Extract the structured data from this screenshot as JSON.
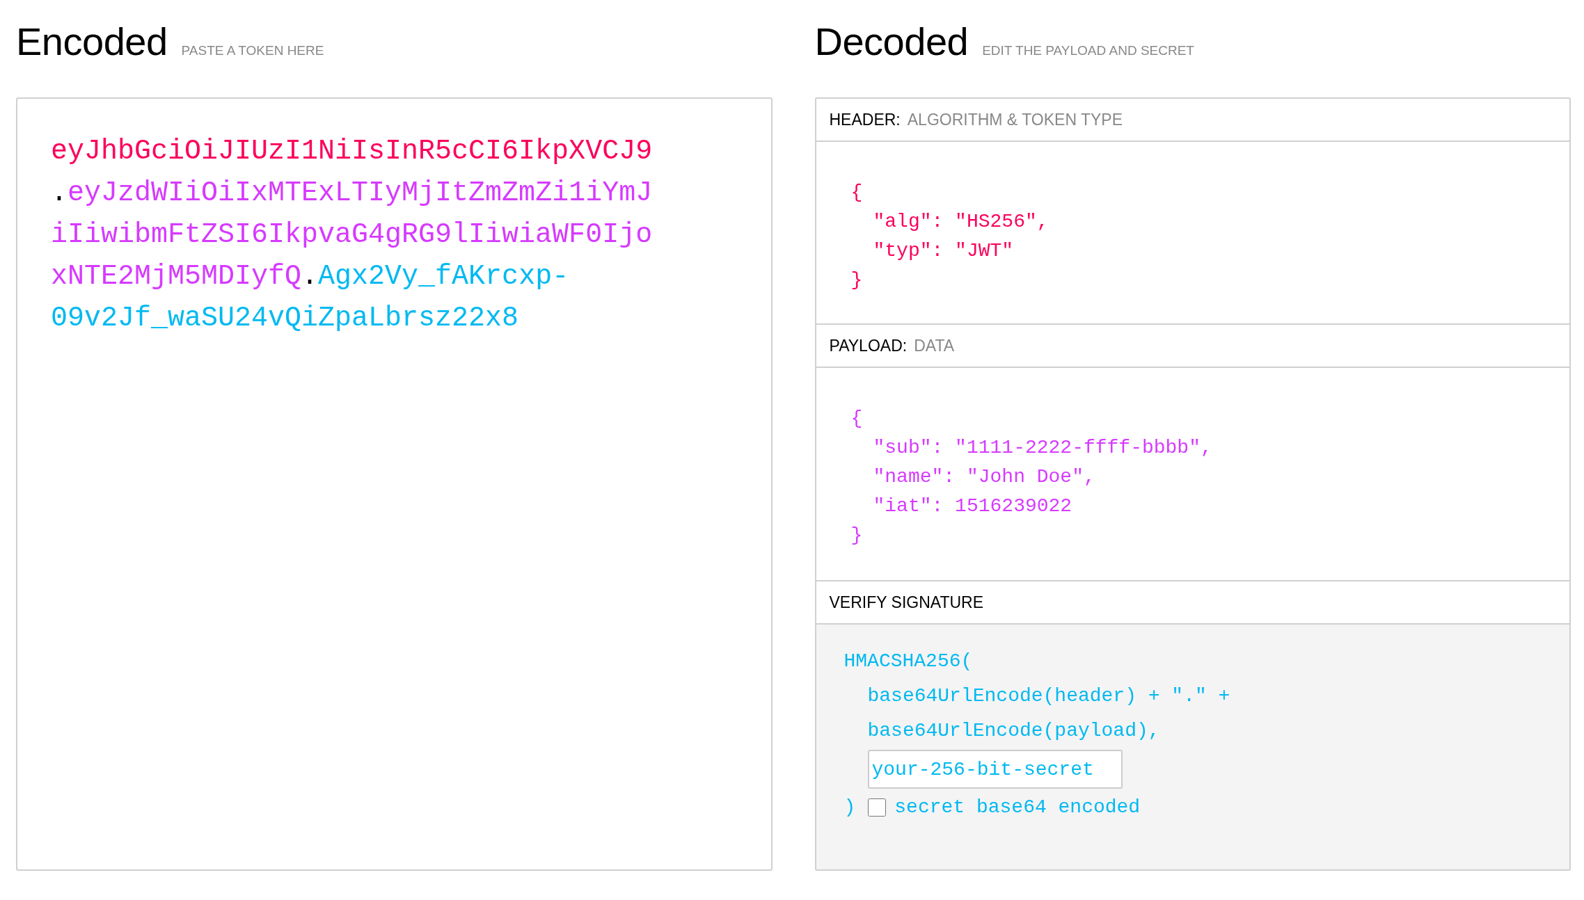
{
  "encoded": {
    "title": "Encoded",
    "subtitle": "PASTE A TOKEN HERE",
    "token": [
      {
        "kind": "header",
        "text": "eyJhbGciOiJIUzI1NiIsInR5cCI6IkpXVCJ9"
      },
      {
        "kind": "separator",
        "text": "."
      },
      {
        "kind": "payload",
        "text": "eyJzdWIiOiIxMTExLTIyMjItZmZmZi1iYmJiIiwibmFtZSI6IkpvaG4gRG9lIiwiaWF0IjoxNTE2MjM5MDIyfQ"
      },
      {
        "kind": "separator",
        "text": "."
      },
      {
        "kind": "signature",
        "text": "Agx2Vy_fAKrcxp-09v2Jf_waSU24vQiZpaLbrsz22x8"
      }
    ]
  },
  "decoded": {
    "title": "Decoded",
    "subtitle": "EDIT THE PAYLOAD AND SECRET",
    "header": {
      "label": "HEADER:",
      "sublabel": "ALGORITHM & TOKEN TYPE",
      "open": "{",
      "entries": [
        "\"alg\": \"HS256\",",
        "\"typ\": \"JWT\""
      ],
      "close": "}"
    },
    "payload": {
      "label": "PAYLOAD:",
      "sublabel": "DATA",
      "open": "{",
      "entries": [
        "\"sub\": \"1111-2222-ffff-bbbb\",",
        "\"name\": \"John Doe\",",
        "\"iat\": 1516239022"
      ],
      "close": "}"
    },
    "verify": {
      "label": "VERIFY SIGNATURE",
      "call": "HMACSHA256(",
      "args": [
        "base64UrlEncode(header) + \".\" +",
        "base64UrlEncode(payload),"
      ],
      "secret": {
        "value": "your-256-bit-secret"
      },
      "close": ")",
      "base64_checkbox": {
        "label": "secret base64 encoded",
        "checked": false
      }
    }
  }
}
